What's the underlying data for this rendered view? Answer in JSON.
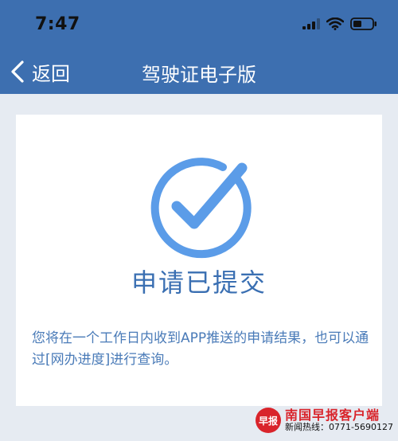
{
  "status_bar": {
    "time": "7:47",
    "icons": [
      "cellular-signal-icon",
      "wifi-icon",
      "battery-icon"
    ]
  },
  "nav": {
    "back_label": "返回",
    "title": "驾驶证电子版",
    "background_color": "#3d6fb0"
  },
  "result": {
    "icon": "check-circle-icon",
    "icon_color": "#5b9ce8",
    "title": "申请已提交",
    "description": "您将在一个工作日内收到APP推送的申请结果，也可以通过[网办进度]进行查询。"
  },
  "watermark": {
    "logo_text": "早报",
    "name": "南国早报客户端",
    "hotline": "新闻热线：0771-5690127",
    "color": "#d9242b"
  }
}
